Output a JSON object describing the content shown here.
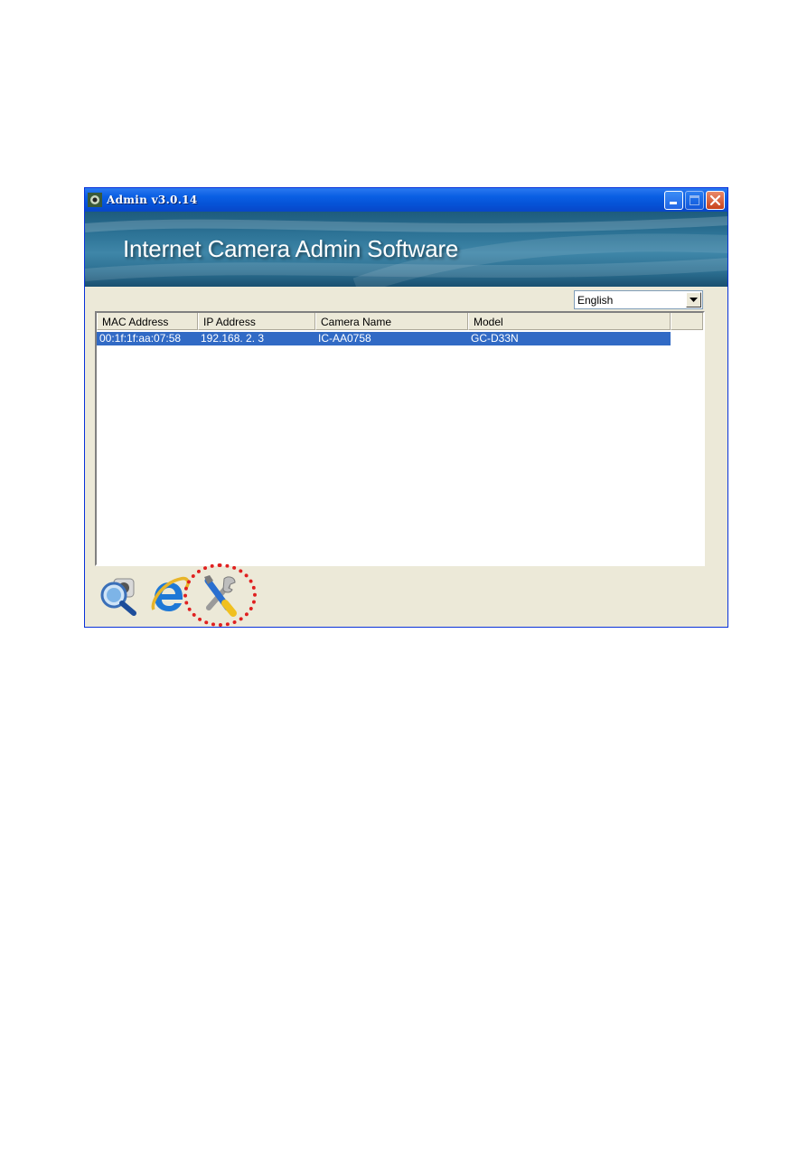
{
  "window": {
    "title": "Admin v3.0.14",
    "banner_title": "Internet Camera Admin Software"
  },
  "language_select": {
    "selected": "English"
  },
  "table": {
    "columns": [
      "MAC Address",
      "IP Address",
      "Camera Name",
      "Model"
    ],
    "rows": [
      {
        "mac": "00:1f:1f:aa:07:58",
        "ip": "192.168.  2.  3",
        "name": "IC-AA0758",
        "model": "GC-D33N"
      }
    ]
  },
  "toolbar": {
    "icons": [
      "search-camera-icon",
      "internet-explorer-icon",
      "tools-icon"
    ]
  },
  "colors": {
    "title_bar": "#0a5fe4",
    "selection": "#316ac5",
    "highlight_ring": "#e02020"
  }
}
